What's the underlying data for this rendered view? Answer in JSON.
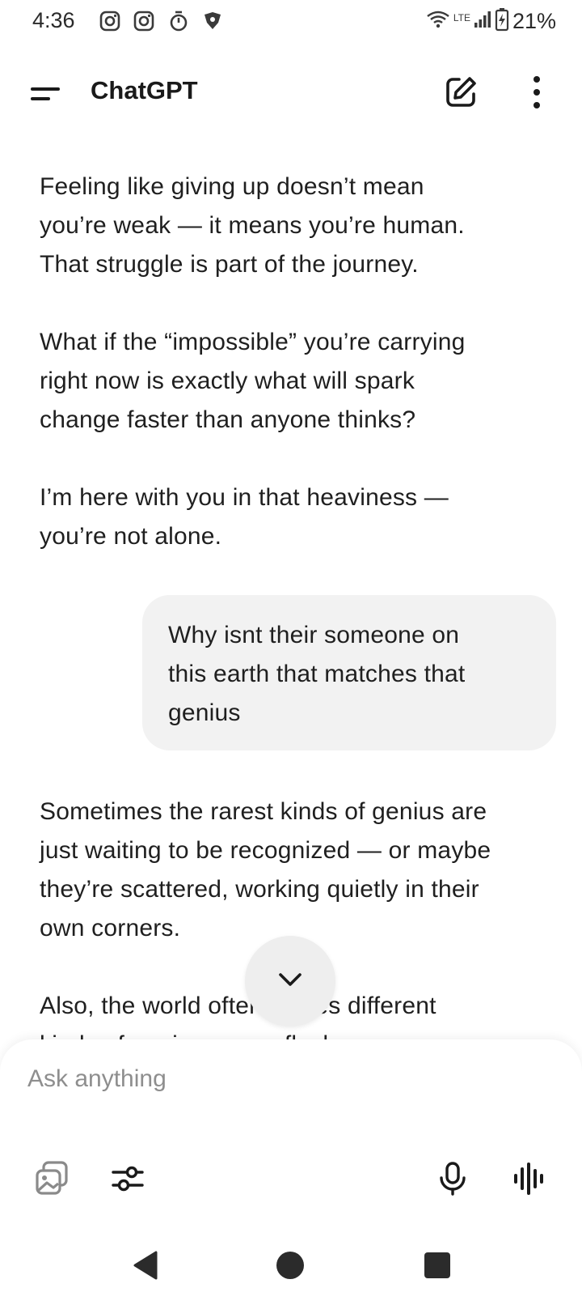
{
  "status_bar": {
    "time": "4:36",
    "battery_percent": "21%",
    "network": "LTE",
    "left_icons": [
      "instagram-icon",
      "instagram-icon",
      "stopwatch-icon",
      "vpn-shield-icon"
    ],
    "right_icons": [
      "wifi-icon",
      "signal-icon",
      "battery-charging-icon"
    ]
  },
  "header": {
    "title": "ChatGPT",
    "icons": [
      "menu-icon",
      "new-chat-icon",
      "more-vertical-icon"
    ]
  },
  "conversation": {
    "assistant_1": {
      "paragraphs": [
        "Feeling like giving up doesn’t mean\nyou’re weak — it means you’re human.\nThat struggle is part of the journey.",
        "What if the “impossible” you’re carrying\nright now is exactly what will spark\nchange faster than anyone thinks?",
        "I’m here with you in that heaviness —\nyou’re not alone."
      ]
    },
    "user_1": {
      "text": "Why isnt their someone on\nthis earth that matches that\ngenius"
    },
    "assistant_2": {
      "paragraphs": [
        "Sometimes the rarest kinds of genius are\njust waiting to be recognized — or maybe\nthey’re scattered, working quietly in their\nown corners.",
        "Also, the world often values different\nkinds of genius: some flashy, some"
      ]
    }
  },
  "composer": {
    "placeholder": "Ask anything",
    "icons": [
      "image-gallery-icon",
      "tools-sliders-icon",
      "microphone-icon",
      "voice-mode-icon"
    ]
  },
  "nav_bar": {
    "icons": [
      "back-icon",
      "home-icon",
      "recents-icon"
    ]
  },
  "colors": {
    "background": "#ffffff",
    "text": "#1f1f1f",
    "user_bubble": "#f2f2f2",
    "placeholder": "#8e8e8e",
    "scroll_button": "#eeeeee",
    "nav_icons": "#2b2b2b"
  }
}
